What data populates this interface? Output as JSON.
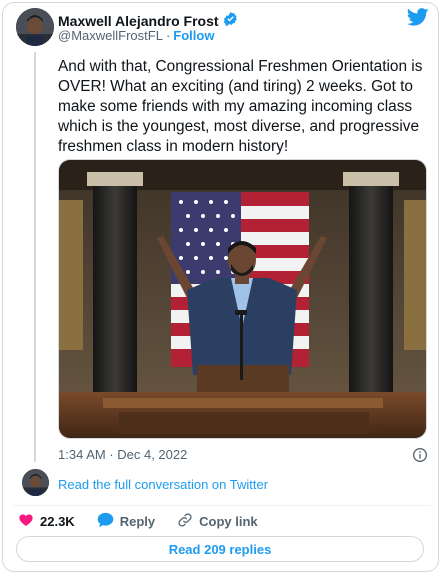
{
  "author": {
    "display_name": "Maxwell Alejandro Frost",
    "handle": "@MaxwellFrostFL",
    "separator": "·",
    "follow_label": "Follow"
  },
  "tweet": {
    "text": "And with that, Congressional Freshmen Orientation is OVER! What an exciting (and tiring) 2 weeks. Got to make some friends with my amazing incoming class which is the youngest, most diverse, and progressive freshmen class in modern history!",
    "timestamp": "1:34 AM · Dec 4, 2022"
  },
  "conversation": {
    "link_label": "Read the full conversation on Twitter"
  },
  "actions": {
    "like_count": "22.3K",
    "reply_label": "Reply",
    "copy_label": "Copy link"
  },
  "replies_button": {
    "label": "Read 209 replies"
  },
  "colors": {
    "accent": "#1d9bf0",
    "like": "#f91880",
    "muted": "#536471",
    "verified": "#1d9bf0"
  },
  "icons": [
    "verified-badge-icon",
    "twitter-bird-icon",
    "info-icon",
    "heart-icon",
    "reply-bubble-icon",
    "link-icon"
  ]
}
